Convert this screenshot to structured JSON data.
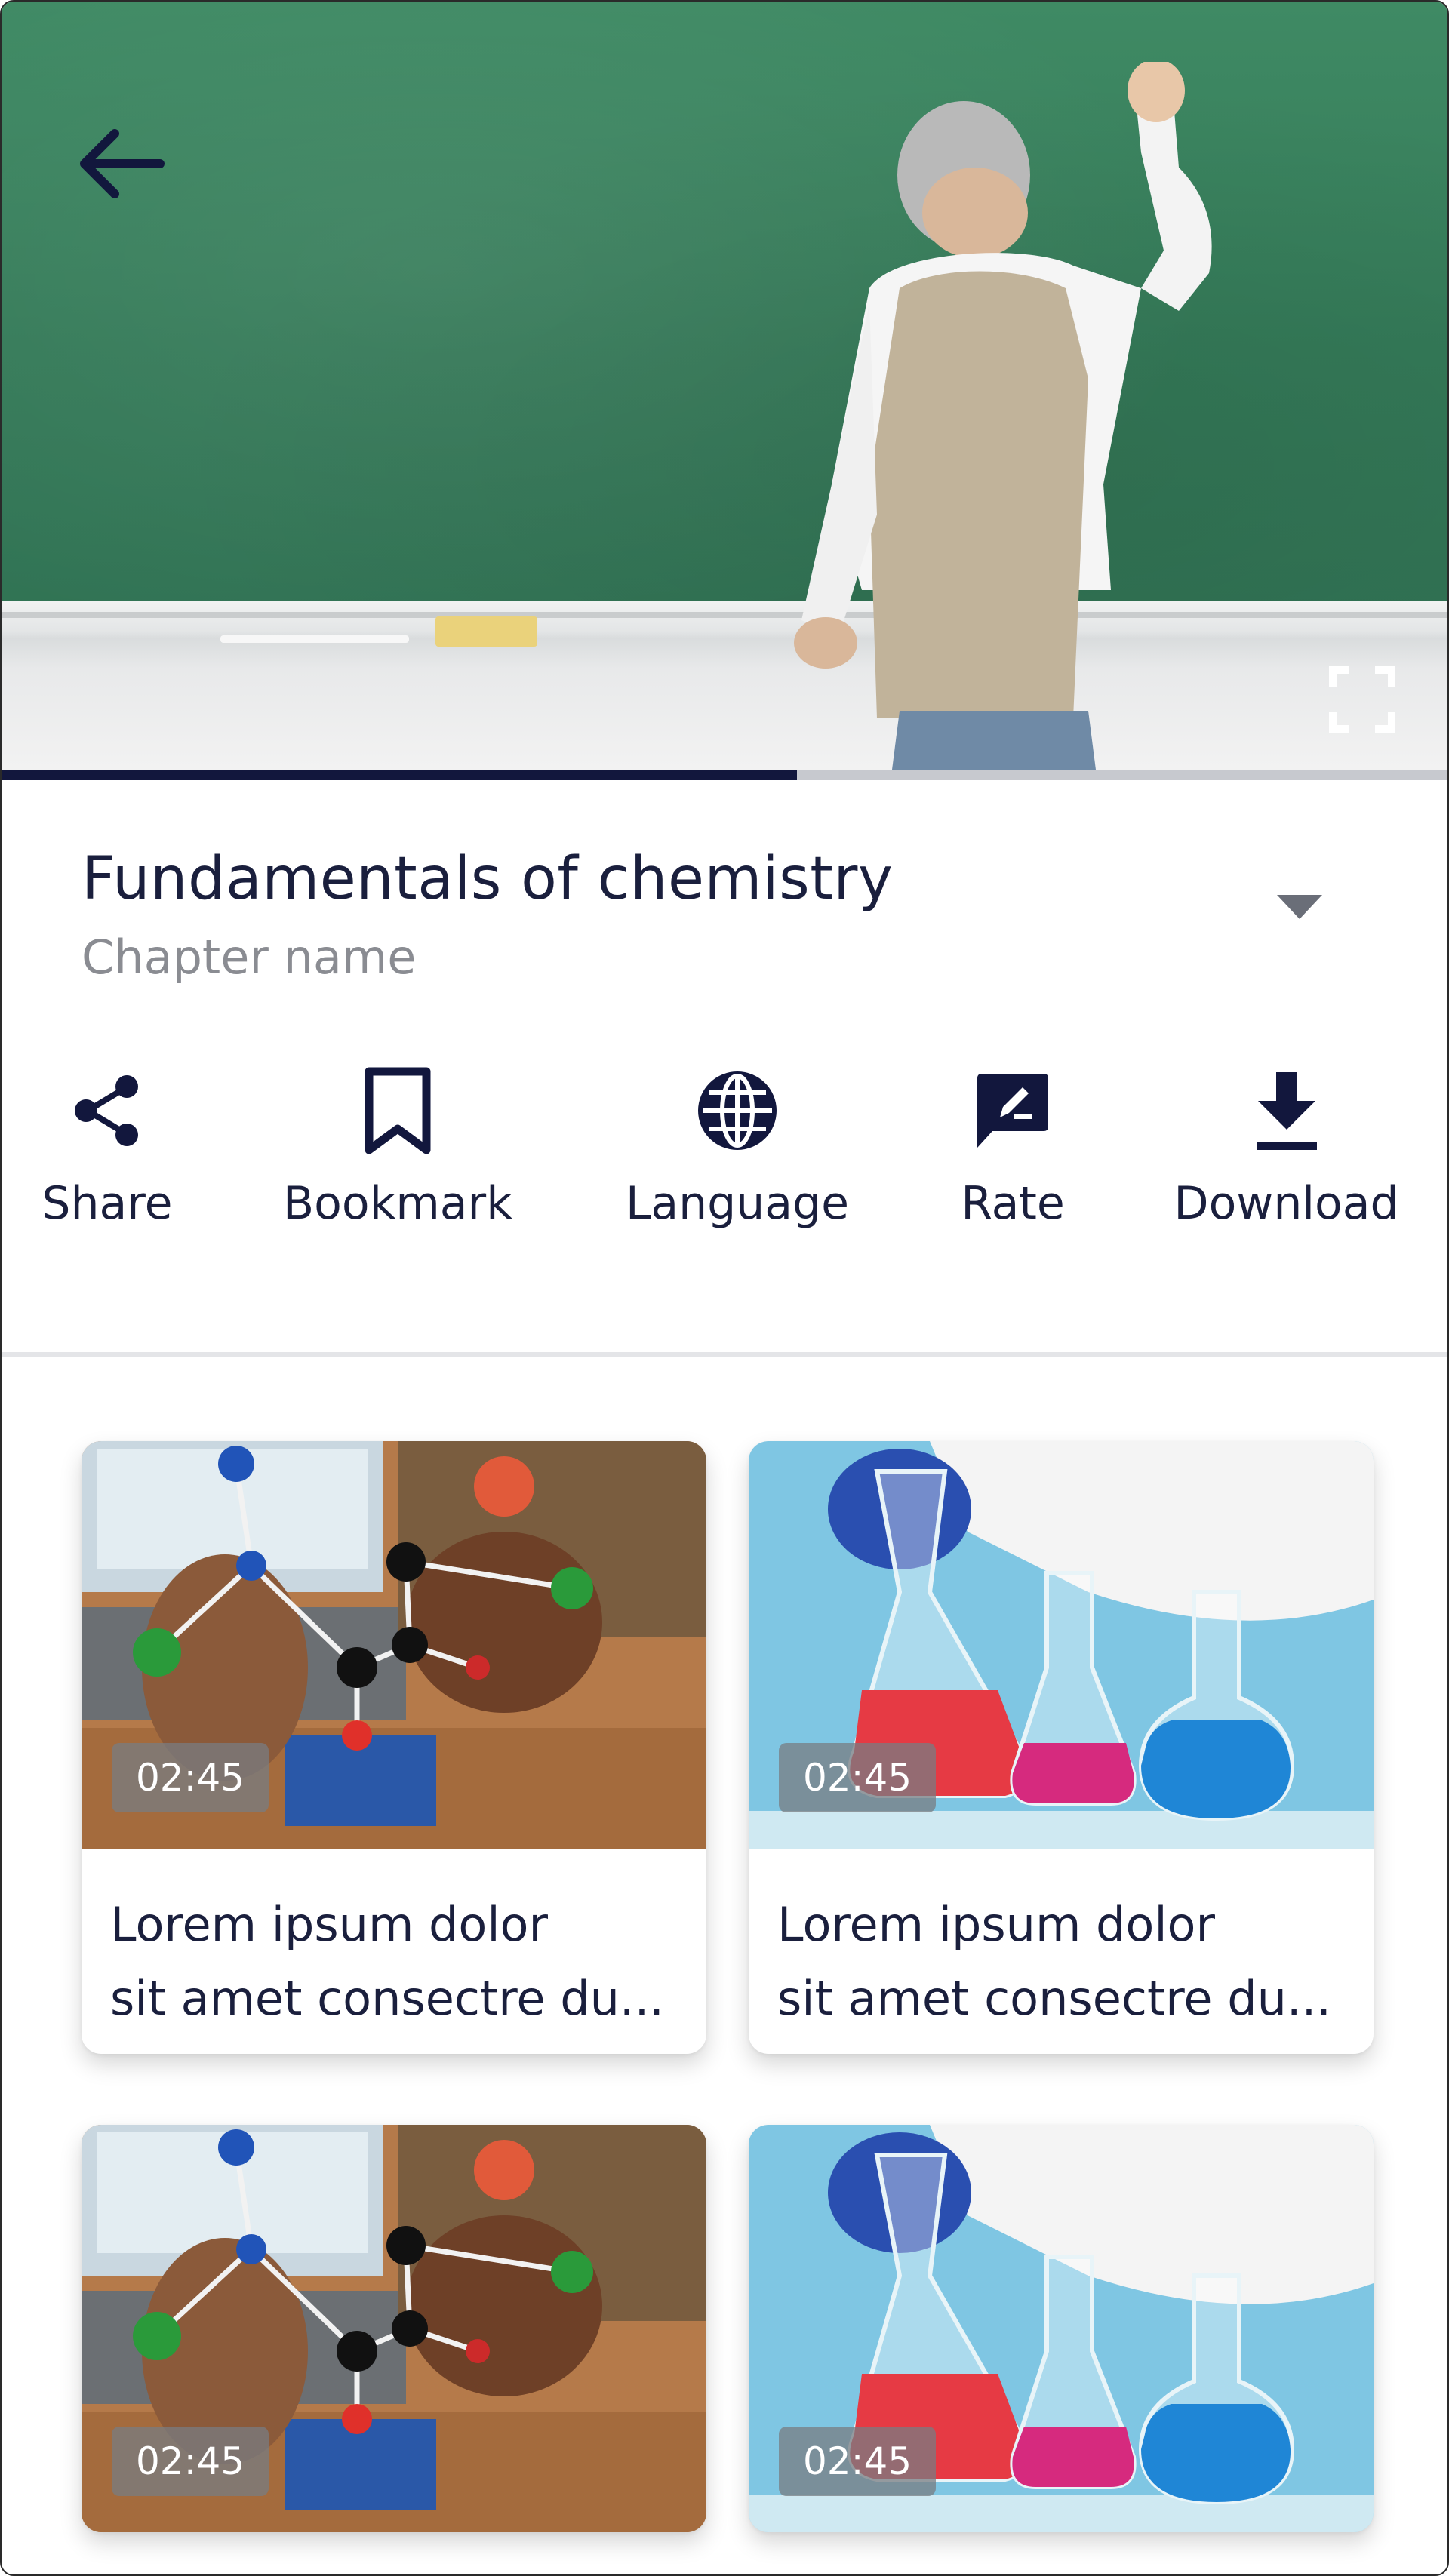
{
  "player": {
    "progress": 0.55,
    "back_icon": "arrow-left-icon",
    "fullscreen_icon": "fullscreen-icon",
    "colors": {
      "progress_fill": "#12173d",
      "progress_track": "#c7c9cf"
    }
  },
  "header": {
    "title": "Fundamentals of chemistry",
    "subtitle": "Chapter name",
    "dropdown_icon": "caret-down-icon"
  },
  "actions": [
    {
      "id": "share",
      "label": "Share",
      "icon": "share-icon"
    },
    {
      "id": "bookmark",
      "label": "Bookmark",
      "icon": "bookmark-icon"
    },
    {
      "id": "language",
      "label": "Language",
      "icon": "globe-icon"
    },
    {
      "id": "rate",
      "label": "Rate",
      "icon": "rate-icon"
    },
    {
      "id": "download",
      "label": "Download",
      "icon": "download-icon"
    }
  ],
  "videos": [
    {
      "duration": "02:45",
      "line1": "Lorem ipsum dolor",
      "line2": "sit amet consectre du...",
      "thumbnail": "molecule-model"
    },
    {
      "duration": "02:45",
      "line1": "Lorem ipsum dolor",
      "line2": "sit amet consectre du...",
      "thumbnail": "lab-flasks"
    },
    {
      "duration": "02:45",
      "line1": "",
      "line2": "",
      "thumbnail": "molecule-model"
    },
    {
      "duration": "02:45",
      "line1": "",
      "line2": "",
      "thumbnail": "lab-flasks"
    }
  ],
  "colors": {
    "text": "#1a1f3d",
    "muted": "#8a8c92",
    "accent": "#12173d"
  }
}
